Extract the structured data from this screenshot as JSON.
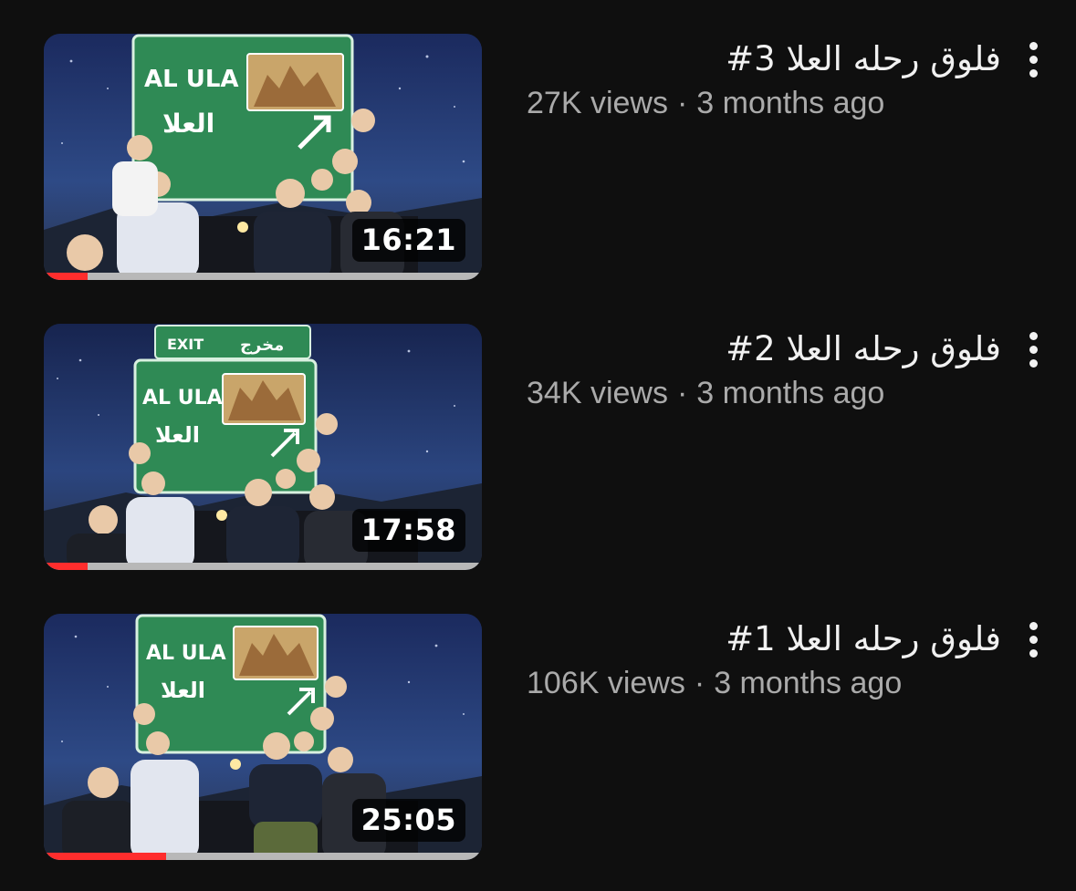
{
  "videos": [
    {
      "title": "فلوق رحله العلا 3#",
      "views": "27K views",
      "separator": "·",
      "age": "3 months ago",
      "duration": "16:21",
      "progress": 0.1,
      "thumbnail": {
        "sign_en": "AL ULA",
        "sign_ar": "العلا",
        "exit_en": "",
        "exit_ar": ""
      }
    },
    {
      "title": "فلوق رحله العلا 2#",
      "views": "34K views",
      "separator": "·",
      "age": "3 months ago",
      "duration": "17:58",
      "progress": 0.1,
      "thumbnail": {
        "sign_en": "AL ULA",
        "sign_ar": "العلا",
        "exit_en": "EXIT",
        "exit_ar": "مخرج"
      }
    },
    {
      "title": "فلوق رحله العلا 1#",
      "views": "106K views",
      "separator": "·",
      "age": "3 months ago",
      "duration": "25:05",
      "progress": 0.28,
      "thumbnail": {
        "sign_en": "AL ULA",
        "sign_ar": "العلا",
        "exit_en": "",
        "exit_ar": ""
      }
    }
  ],
  "colors": {
    "background": "#0f0f0f",
    "title": "#f1f1f1",
    "meta": "#aaaaaa",
    "progress": "#ff2d2d",
    "sign_green": "#2f8a55"
  },
  "icons": {
    "menu": "more-vertical-icon"
  }
}
